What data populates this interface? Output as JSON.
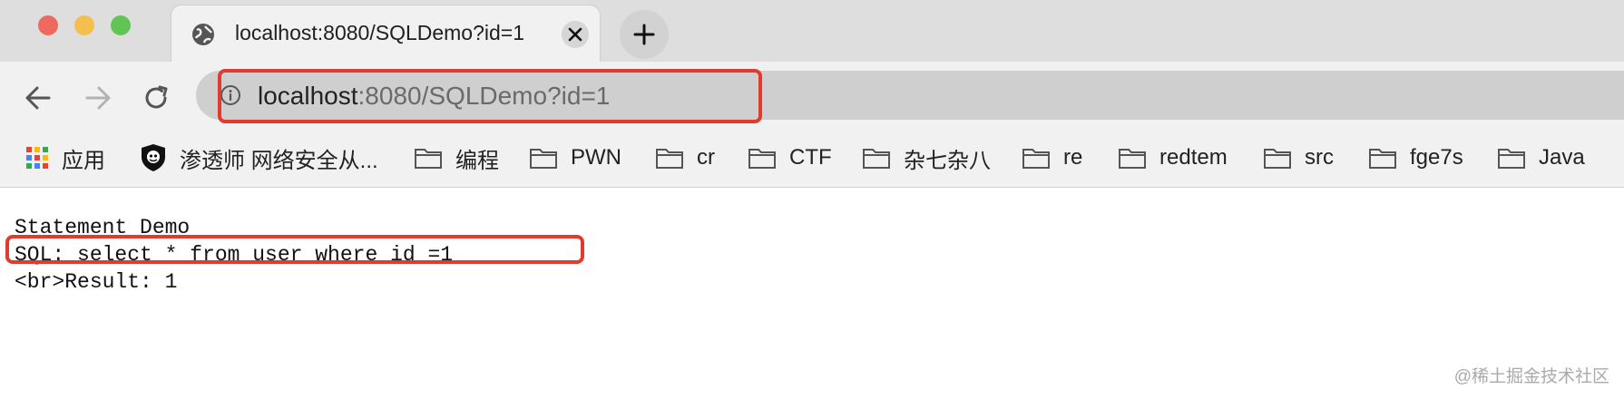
{
  "tab": {
    "title": "localhost:8080/SQLDemo?id=1"
  },
  "address": {
    "host": "localhost",
    "rest": ":8080/SQLDemo?id=1"
  },
  "bookmarks": [
    {
      "label": "应用",
      "icon": "apps-grid-icon"
    },
    {
      "label": "渗透师 网络安全从...",
      "icon": "shield-icon"
    },
    {
      "label": "编程",
      "icon": "folder-icon"
    },
    {
      "label": "PWN",
      "icon": "folder-icon"
    },
    {
      "label": "cr",
      "icon": "folder-icon"
    },
    {
      "label": "CTF",
      "icon": "folder-icon"
    },
    {
      "label": "杂七杂八",
      "icon": "folder-icon"
    },
    {
      "label": "re",
      "icon": "folder-icon"
    },
    {
      "label": "redtem",
      "icon": "folder-icon"
    },
    {
      "label": "src",
      "icon": "folder-icon"
    },
    {
      "label": "fge7s",
      "icon": "folder-icon"
    },
    {
      "label": "Java",
      "icon": "folder-icon"
    }
  ],
  "page": {
    "line1": "Statement Demo",
    "line2": "SQL: select * from user where id =1",
    "line3": "<br>Result: 1"
  },
  "watermark": "@稀土掘金技术社区",
  "colors": {
    "highlight": "#e23b2e",
    "tabbar": "#dedede",
    "toolbar": "#f1f1f1"
  }
}
